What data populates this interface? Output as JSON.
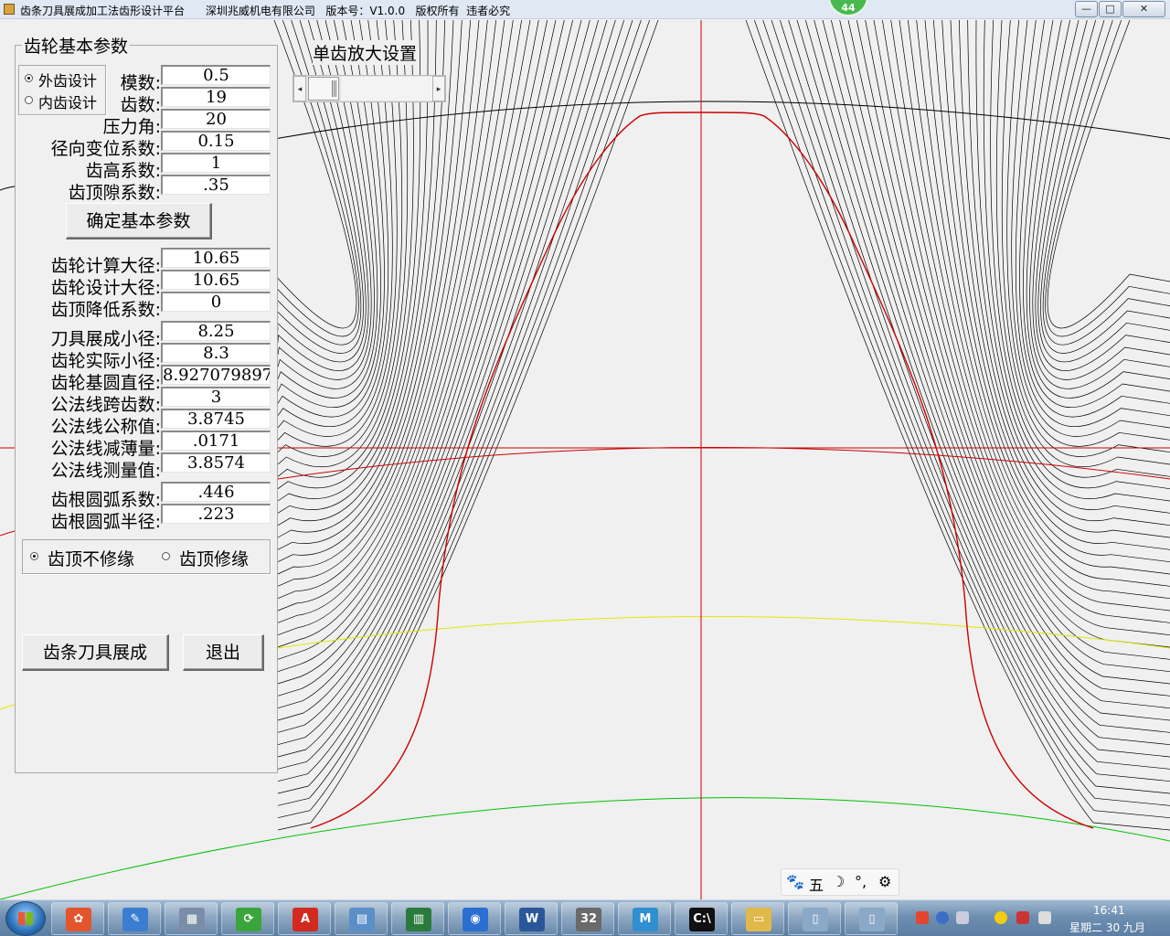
{
  "window": {
    "title": "齿条刀具展成加工法齿形设计平台      深圳兆威机电有限公司   版本号：V1.0.0   版权所有  违者必究",
    "badge": "44",
    "min_label": "—",
    "max_label": "□",
    "close_label": "✕"
  },
  "panel": {
    "title": "齿轮基本参数",
    "gear_type_options": [
      {
        "label": "外齿设计",
        "selected": true
      },
      {
        "label": "内齿设计",
        "selected": false
      }
    ],
    "basic_params": [
      {
        "label": "模数:",
        "value": "0.5"
      },
      {
        "label": "齿数:",
        "value": "19"
      },
      {
        "label": "压力角:",
        "value": "20"
      },
      {
        "label": "径向变位系数:",
        "value": "0.15"
      },
      {
        "label": "齿高系数:",
        "value": "1"
      },
      {
        "label": "齿顶隙系数:",
        "value": ".35"
      }
    ],
    "confirm_button": "确定基本参数",
    "results_a": [
      {
        "label": "齿轮计算大径:",
        "value": "10.65"
      },
      {
        "label": "齿轮设计大径:",
        "value": "10.65"
      },
      {
        "label": "齿顶降低系数:",
        "value": "0"
      }
    ],
    "results_b": [
      {
        "label": "刀具展成小径:",
        "value": "8.25"
      },
      {
        "label": "齿轮实际小径:",
        "value": "8.3"
      },
      {
        "label": "齿轮基圆直径:",
        "value": "8.927079897"
      },
      {
        "label": "公法线跨齿数:",
        "value": "3"
      },
      {
        "label": "公法线公称值:",
        "value": "3.8745"
      },
      {
        "label": "公法线减薄量:",
        "value": ".0171"
      },
      {
        "label": "公法线测量值:",
        "value": "3.8574"
      }
    ],
    "results_c": [
      {
        "label": "齿根圆弧系数:",
        "value": ".446"
      },
      {
        "label": "齿根圆弧半径:",
        "value": ".223"
      }
    ],
    "tip_options": [
      {
        "label": "齿顶不修缘",
        "selected": true
      },
      {
        "label": "齿顶修缘",
        "selected": false
      }
    ],
    "generate_button": "齿条刀具展成",
    "exit_button": "退出"
  },
  "zoom": {
    "label": "单齿放大设置",
    "left_arrow": "◂",
    "right_arrow": "▸"
  },
  "ime": {
    "paw": "🐾",
    "mode": "五",
    "moon": "☽",
    "dots": "°,",
    "gear": "⚙"
  },
  "taskbar": {
    "time": "16:41",
    "date": "星期二 30 九月",
    "apps": [
      {
        "name": "picasa",
        "glyph": "✿",
        "color": "#e2552d"
      },
      {
        "name": "paint",
        "glyph": "✎",
        "color": "#3b7ed1"
      },
      {
        "name": "calculator",
        "glyph": "▦",
        "color": "#7a8fa7"
      },
      {
        "name": "refresh",
        "glyph": "⟳",
        "color": "#3aa53a"
      },
      {
        "name": "pdf",
        "glyph": "A",
        "color": "#d22a1f"
      },
      {
        "name": "notes",
        "glyph": "▤",
        "color": "#5a8fc8"
      },
      {
        "name": "monitor",
        "glyph": "▥",
        "color": "#2b7a3d"
      },
      {
        "name": "globe",
        "glyph": "◉",
        "color": "#2a6ed1"
      },
      {
        "name": "word",
        "glyph": "W",
        "color": "#2b579a"
      },
      {
        "name": "tool32",
        "glyph": "32",
        "color": "#6a6a6a"
      },
      {
        "name": "search-m",
        "glyph": "M",
        "color": "#2f8fd0"
      },
      {
        "name": "cmd",
        "glyph": "C:\\",
        "color": "#111111"
      },
      {
        "name": "folder",
        "glyph": "▭",
        "color": "#e0b94a"
      },
      {
        "name": "window-a",
        "glyph": "▯",
        "color": "#8aa8c8"
      },
      {
        "name": "window-b",
        "glyph": "▯",
        "color": "#8aa8c8"
      }
    ]
  },
  "colors": {
    "tooth_profile": "#cc0000",
    "envelope": "#000000",
    "center_axis": "#cc0000",
    "pitch_circle": "#cc0000",
    "base_circle": "#e6e600",
    "root_circle": "#00c000",
    "tip_circle": "#000000"
  }
}
